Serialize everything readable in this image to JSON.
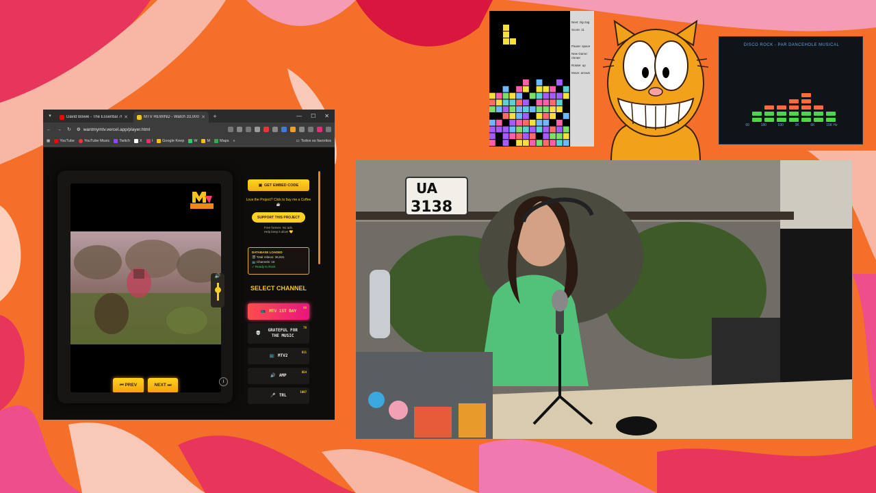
{
  "browser": {
    "tabs": [
      {
        "label": "David Bowie - The Essential 70s",
        "favicon_color": "#ff0000"
      },
      {
        "label": "MTV REWIND - Watch 33,000+",
        "favicon_color": "#f5c518"
      }
    ],
    "address": "wantmymtv.vercel.app/player.html",
    "bookmarks": [
      "YouTube",
      "YouTube Music",
      "Twitch",
      "X",
      "I",
      "Google Keep",
      "W",
      "M",
      "Maps"
    ],
    "bookmarks_folder": "Todos os favoritos"
  },
  "player": {
    "logo_text": "MTV REWIND",
    "prev_label": "⏮ PREV",
    "next_label": "NEXT ⏭",
    "info_icon": "i",
    "volume_icon": "🔊"
  },
  "sidebar": {
    "embed_label": "GET EMBED CODE",
    "love_text": "Love the Project? Click to buy me a Coffee ☕",
    "support_label": "SUPPORT THIS PROJECT",
    "free_text": "Free forever. No ads.\nHelp keep it alive! 💛",
    "database": {
      "title": "DATABASE LOADED",
      "videos": "🎬 Total Videos: 36,831",
      "channels": "📺 Channels: 16",
      "status": "✓ Ready to Rock"
    },
    "select_title": "SELECT CHANNEL",
    "channels": [
      {
        "icon": "📺",
        "name": "MTV 1ST DAY",
        "count": "98",
        "active": true
      },
      {
        "icon": "💀",
        "name": "GRATEFUL FOR THE MUSIC",
        "count": "78",
        "active": false
      },
      {
        "icon": "📺",
        "name": "MTV2",
        "count": "811",
        "active": false
      },
      {
        "icon": "🔊",
        "name": "AMP",
        "count": "854",
        "active": false
      },
      {
        "icon": "🎤",
        "name": "TRL",
        "count": "1097",
        "active": false
      }
    ]
  },
  "tetris": {
    "next_label": "Next: zig-zag",
    "score_label": "Score: 11",
    "controls": [
      "Pause: space",
      "New Game: r/enter",
      "Rotate: up",
      "Move: arrows"
    ]
  },
  "equalizer": {
    "title": "DISCO ROCK - PAR DANCEHOLE MUSICAL",
    "frequencies": [
      "60",
      "180",
      "530",
      "3K",
      "6K",
      "15K Hz"
    ]
  }
}
